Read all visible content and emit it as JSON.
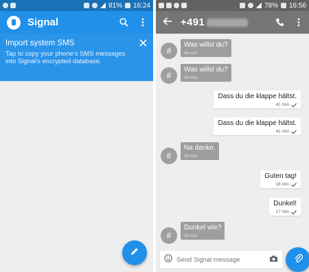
{
  "left_phone": {
    "status": {
      "battery": "81%",
      "time": "16:24"
    },
    "toolbar": {
      "title": "Signal"
    },
    "banner": {
      "title": "Import system SMS",
      "text": "Tap to copy your phone's SMS messages into Signal's encrypted database."
    }
  },
  "right_phone": {
    "status": {
      "battery": "78%",
      "time": "16:56"
    },
    "toolbar": {
      "contact": "+491"
    },
    "messages": [
      {
        "dir": "in",
        "text": "Was willst du?",
        "time": "44 min"
      },
      {
        "dir": "in",
        "text": "Was willst du?",
        "time": "44 min"
      },
      {
        "dir": "out",
        "text": "Dass du die klappe hältst.",
        "time": "41 min"
      },
      {
        "dir": "out",
        "text": "Dass du die klappe hältst.",
        "time": "41 min"
      },
      {
        "dir": "in",
        "text": "Na danke.",
        "time": "29 min"
      },
      {
        "dir": "out",
        "text": "Guten tag!",
        "time": "18 min"
      },
      {
        "dir": "out",
        "text": "Dunkel!",
        "time": "17 min"
      },
      {
        "dir": "in",
        "text": "Dunkel wie?",
        "time": "16 min"
      }
    ],
    "avatar_glyph": "#",
    "composer": {
      "placeholder": "Send Signal message"
    }
  },
  "colors": {
    "signal_blue": "#2090ea",
    "signal_blue_dark": "#1a72b6",
    "grey_toolbar": "#757575",
    "incoming_bubble": "#9e9e9e"
  },
  "icons": [
    "search-icon",
    "overflow-menu-icon",
    "close-icon",
    "pencil-icon",
    "back-arrow-icon",
    "phone-call-icon",
    "emoji-icon",
    "camera-icon",
    "paperclip-icon"
  ]
}
